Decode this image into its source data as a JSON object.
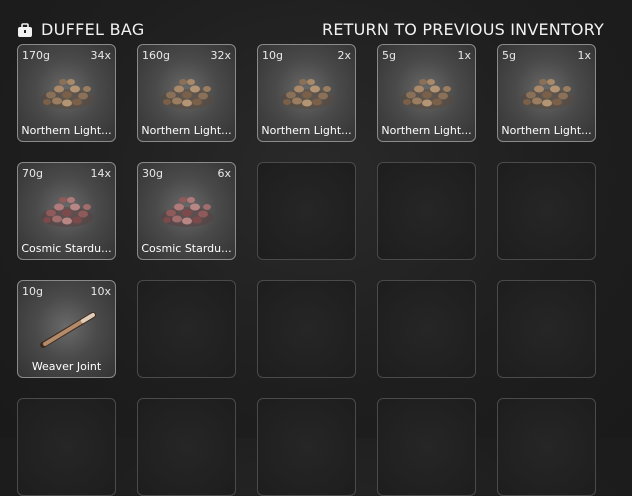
{
  "header": {
    "title": "DUFFEL BAG",
    "return_label": "RETURN TO PREVIOUS INVENTORY",
    "icon": "duffel-bag-icon"
  },
  "slots": [
    {
      "weight": "170g",
      "count": "34x",
      "name": "Northern Light...",
      "icon": "cannabis-buds-icon"
    },
    {
      "weight": "160g",
      "count": "32x",
      "name": "Northern Light...",
      "icon": "cannabis-buds-icon"
    },
    {
      "weight": "10g",
      "count": "2x",
      "name": "Northern Light...",
      "icon": "cannabis-buds-icon"
    },
    {
      "weight": "5g",
      "count": "1x",
      "name": "Northern Light...",
      "icon": "cannabis-buds-icon"
    },
    {
      "weight": "5g",
      "count": "1x",
      "name": "Northern Light...",
      "icon": "cannabis-buds-icon"
    },
    {
      "weight": "70g",
      "count": "14x",
      "name": "Cosmic Stardu...",
      "icon": "cannabis-buds-pink-icon"
    },
    {
      "weight": "30g",
      "count": "6x",
      "name": "Cosmic Stardu...",
      "icon": "cannabis-buds-pink-icon"
    },
    {
      "weight": "10g",
      "count": "10x",
      "name": "Weaver Joint",
      "icon": "joint-icon"
    }
  ],
  "colors": {
    "background": "#1e1e1e",
    "slot_border_filled": "#8a8a8a",
    "slot_border_empty": "#4a4a4a"
  }
}
